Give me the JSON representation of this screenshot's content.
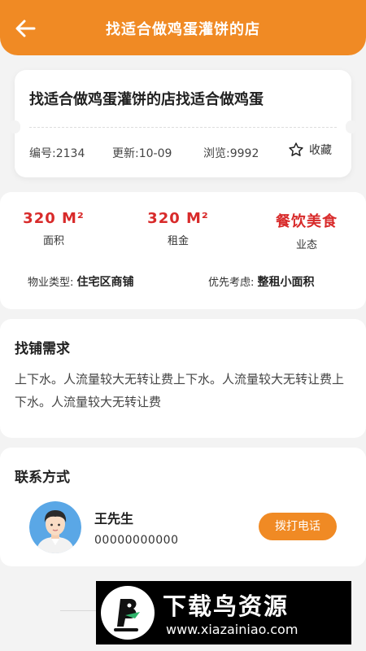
{
  "header": {
    "title": "找适合做鸡蛋灌饼的店",
    "back_icon": "arrow-left-icon"
  },
  "listing": {
    "title": "找适合做鸡蛋灌饼的店找适合做鸡蛋",
    "id_text": "编号:2134",
    "updated_text": "更新:10-09",
    "views_text": "浏览:9992",
    "favorite_label": "收藏",
    "favorite_icon": "star-outline-icon"
  },
  "stats": [
    {
      "value": "320 M²",
      "label": "面积"
    },
    {
      "value": "320 M²",
      "label": "租金"
    },
    {
      "value": "餐饮美食",
      "label": "业态"
    }
  ],
  "properties": {
    "type_label": "物业类型:",
    "type_value": "住宅区商铺",
    "priority_label": "优先考虑:",
    "priority_value": "整租小面积"
  },
  "requirements": {
    "title": "找铺需求",
    "text": "上下水。人流量较大无转让费上下水。人流量较大无转让费上下水。人流量较大无转让费"
  },
  "contact": {
    "title": "联系方式",
    "name": "王先生",
    "phone": "00000000000",
    "call_label": "拨打电话"
  },
  "watermark": {
    "title": "下载鸟资源",
    "url": "www.xiazainiao.com"
  },
  "colors": {
    "accent": "#f08a24",
    "price": "#d82a2a",
    "background": "#f3f3f3"
  }
}
